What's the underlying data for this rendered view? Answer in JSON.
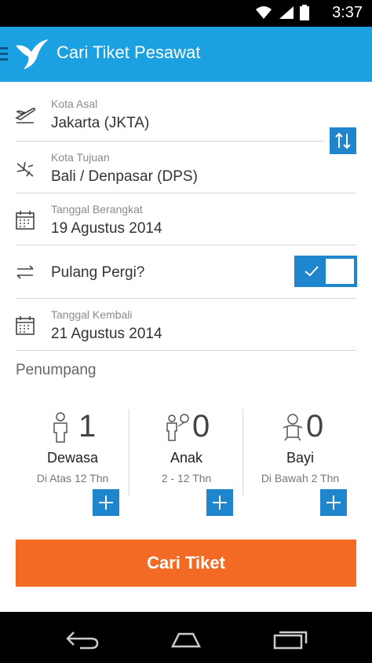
{
  "status_bar": {
    "time": "3:37",
    "icons": [
      "wifi-icon",
      "signal-icon",
      "battery-icon"
    ]
  },
  "app_bar": {
    "title": "Cari Tiket Pesawat",
    "icons": [
      "menu-icon",
      "bird-logo-icon"
    ]
  },
  "form": {
    "origin": {
      "label": "Kota Asal",
      "value": "Jakarta (JKTA)",
      "icon": "plane-takeoff-icon"
    },
    "destination": {
      "label": "Kota Tujuan",
      "value": "Bali / Denpasar (DPS)",
      "icon": "plane-landing-icon"
    },
    "depart_date": {
      "label": "Tanggal Berangkat",
      "value": "19 Agustus 2014",
      "icon": "calendar-icon"
    },
    "round_trip": {
      "label": "Pulang Pergi?",
      "enabled": true,
      "icon": "swap-arrows-icon"
    },
    "return_date": {
      "label": "Tanggal Kembali",
      "value": "21 Agustus 2014",
      "icon": "calendar-icon"
    },
    "swap_icon": "swap-vertical-icon"
  },
  "passengers": {
    "section_title": "Penumpang",
    "groups": [
      {
        "count": "1",
        "name": "Dewasa",
        "subtitle": "Di Atas 12 Thn",
        "icon": "adult-icon"
      },
      {
        "count": "0",
        "name": "Anak",
        "subtitle": "2 - 12 Thn",
        "icon": "child-icon"
      },
      {
        "count": "0",
        "name": "Bayi",
        "subtitle": "Di Bawah 2 Thn",
        "icon": "infant-icon"
      }
    ]
  },
  "search_button": {
    "label": "Cari Tiket"
  },
  "colors": {
    "primary": "#1ba0e1",
    "accent_blue": "#1f85cc",
    "cta_orange": "#f26a24"
  },
  "nav_bar": {
    "icons": [
      "back-icon",
      "home-icon",
      "recents-icon"
    ]
  }
}
